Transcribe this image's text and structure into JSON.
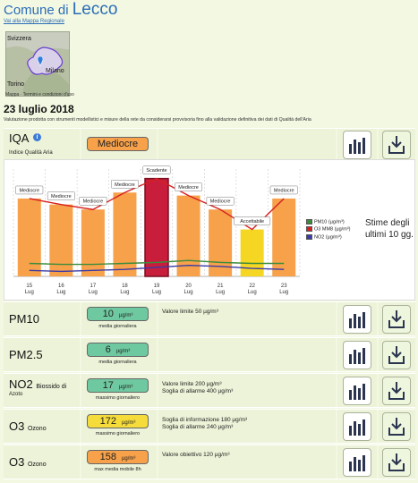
{
  "header": {
    "title_prefix": "Comune di",
    "city": "Lecco",
    "back_link": "Vai alla Mappa Regionale"
  },
  "map": {
    "labels": [
      "Svizzera",
      "Milano",
      "Torino"
    ],
    "footer": "Mappa · Termini e condizioni d'uso"
  },
  "date": "23 luglio 2018",
  "disclaimer": "Valutazione prodotta con strumenti modellistici e misure della rete da considerarsi provvisoria fino alla validazione definitiva dei dati di Qualità dell'Aria",
  "iqa": {
    "name": "IQA",
    "subtitle": "Indice Qualità Aria",
    "value": "Mediocre",
    "value_color": "#f7a14a",
    "info_icon": "info-icon"
  },
  "chart_data": {
    "type": "bar",
    "categories": [
      "15\nLug",
      "16\nLug",
      "17\nLug",
      "18\nLug",
      "19\nLug",
      "20\nLug",
      "21\nLug",
      "22\nLug",
      "23\nLug"
    ],
    "x_labels": [
      [
        "15",
        "Lug"
      ],
      [
        "16",
        "Lug"
      ],
      [
        "17",
        "Lug"
      ],
      [
        "18",
        "Lug"
      ],
      [
        "19",
        "Lug"
      ],
      [
        "20",
        "Lug"
      ],
      [
        "21",
        "Lug"
      ],
      [
        "22",
        "Lug"
      ],
      [
        "23",
        "Lug"
      ]
    ],
    "bar_levels": [
      0.78,
      0.72,
      0.67,
      0.84,
      0.98,
      0.81,
      0.67,
      0.47,
      0.78
    ],
    "bar_labels": [
      "Mediocre",
      "Mediocre",
      "Mediocre",
      "Mediocre",
      "Scadente",
      "Mediocre",
      "Mediocre",
      "Accettabile",
      "Mediocre"
    ],
    "bar_colors": [
      "#f7a14a",
      "#f7a14a",
      "#f7a14a",
      "#f7a14a",
      "#c81e3c",
      "#f7a14a",
      "#f7a14a",
      "#f5d622",
      "#f7a14a"
    ],
    "series": [
      {
        "name": "PM10 (µg/m³)",
        "color": "#3c8c3c",
        "values": [
          0.13,
          0.12,
          0.12,
          0.13,
          0.14,
          0.16,
          0.14,
          0.13,
          0.13
        ]
      },
      {
        "name": "O3 MM8 (µg/m³)",
        "color": "#d62020",
        "values": [
          0.78,
          0.72,
          0.67,
          0.84,
          0.98,
          0.81,
          0.67,
          0.47,
          0.78
        ]
      },
      {
        "name": "NO2 (µg/m³)",
        "color": "#3a3aa8",
        "values": [
          0.06,
          0.05,
          0.06,
          0.07,
          0.09,
          0.11,
          0.1,
          0.08,
          0.07
        ]
      }
    ],
    "legend_position": "right",
    "side_text": [
      "Stime degli",
      "ultimi 10 gg."
    ]
  },
  "rows": [
    {
      "name": "PM10",
      "name_small": "",
      "name_sub": "",
      "value": "10",
      "unit": "µg/m³",
      "sub": "media giornaliera",
      "color": "#6fc9a0",
      "info": [
        "Valore limite 50 µg/m³"
      ]
    },
    {
      "name": "PM2.5",
      "name_small": "",
      "name_sub": "",
      "value": "6",
      "unit": "µg/m³",
      "sub": "media giornaliera",
      "color": "#6fc9a0",
      "info": []
    },
    {
      "name": "NO2",
      "name_small": "Biossido di",
      "name_sub": "Azoto",
      "value": "17",
      "unit": "µg/m³",
      "sub": "massimo giornaliero",
      "color": "#6fc9a0",
      "info": [
        "Valore limite 200 µg/m³",
        "Soglia di allarme 400 µg/m³"
      ]
    },
    {
      "name": "O3",
      "name_small": "Ozono",
      "name_sub": "",
      "value": "172",
      "unit": "µg/m³",
      "sub": "massimo giornaliero",
      "color": "#f5dc3a",
      "info": [
        "Soglia di informazione 180 µg/m³",
        "Soglia di allarme 240 µg/m³"
      ]
    },
    {
      "name": "O3",
      "name_small": "Ozono",
      "name_sub": "",
      "value": "158",
      "unit": "µg/m³",
      "sub": "max media mobile 8h",
      "color": "#f7a14a",
      "info": [
        "Valore obiettivo 120 µg/m³"
      ]
    }
  ]
}
